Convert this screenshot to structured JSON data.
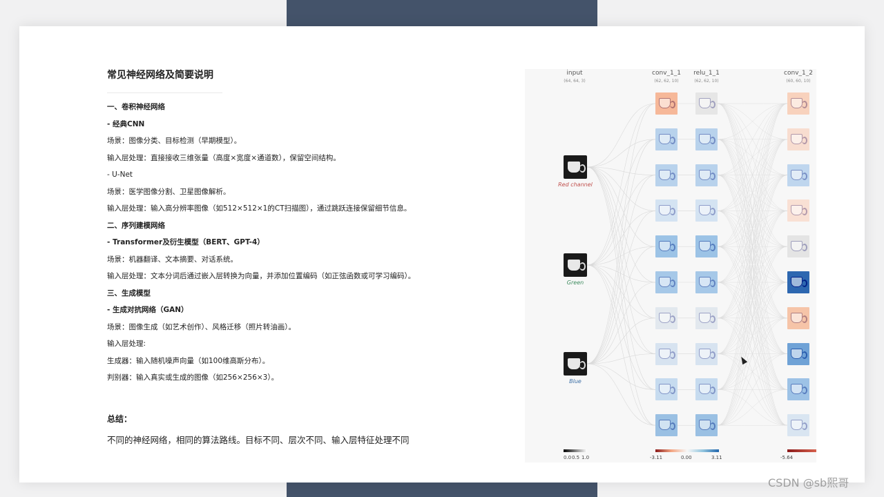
{
  "slide": {
    "title": "常见神经网络及简要说明",
    "lines": [
      {
        "text": "一、卷积神经网络",
        "bold": true
      },
      {
        "text": "- 经典CNN",
        "bold": true
      },
      {
        "text": "场景：图像分类、目标检测（早期模型）。",
        "bold": false
      },
      {
        "text": "输入层处理：直接接收三维张量（高度×宽度×通道数），保留空间结构。",
        "bold": false
      },
      {
        "text": "- U-Net",
        "bold": false
      },
      {
        "text": "场景：医学图像分割、卫星图像解析。",
        "bold": false
      },
      {
        "text": "输入层处理：输入高分辨率图像（如512×512×1的CT扫描图），通过跳跃连接保留细节信息。",
        "bold": false
      },
      {
        "text": "二、序列建模网络",
        "bold": true
      },
      {
        "text": "- Transformer及衍生模型（BERT、GPT-4）",
        "bold": true
      },
      {
        "text": "场景：机器翻译、文本摘要、对话系统。",
        "bold": false
      },
      {
        "text": "输入层处理：文本分词后通过嵌入层转换为向量，并添加位置编码（如正弦函数或可学习编码）。",
        "bold": false
      },
      {
        "text": "三、生成模型",
        "bold": true
      },
      {
        "text": "- 生成对抗网络（GAN）",
        "bold": true
      },
      {
        "text": "场景：图像生成（如艺术创作）、风格迁移（照片转油画）。",
        "bold": false
      },
      {
        "text": "输入层处理:",
        "bold": false
      },
      {
        "text": "生成器：输入随机噪声向量（如100维高斯分布）。",
        "bold": false
      },
      {
        "text": "判别器：输入真实或生成的图像（如256×256×3）。",
        "bold": false
      }
    ],
    "summary_label": "总结：",
    "summary_text": "不同的神经网络，相同的算法路线。目标不同、层次不同、输入层特征处理不同"
  },
  "viz": {
    "layers": [
      {
        "name": "input",
        "dims": "(64, 64, 3)"
      },
      {
        "name": "conv_1_1",
        "dims": "(62, 62, 10)"
      },
      {
        "name": "relu_1_1",
        "dims": "(62, 62, 10)"
      },
      {
        "name": "conv_1_2",
        "dims": "(60, 60, 10)"
      }
    ],
    "inputs": [
      {
        "label": "Red channel",
        "color": "#c0504d"
      },
      {
        "label": "Green",
        "color": "#3d8b5e"
      },
      {
        "label": "Blue",
        "color": "#3a6ea5"
      }
    ],
    "conv1_tints": [
      "#f6b899",
      "#b8d2ec",
      "#b8d2ec",
      "#d4e3f2",
      "#9cc3e6",
      "#a6c8e8",
      "#e2e8ee",
      "#d7e3f0",
      "#c6dbef",
      "#9ac0e3"
    ],
    "relu1_tints": [
      "#e6e6e6",
      "#b8d2ec",
      "#b8d2ec",
      "#d4e3f2",
      "#9cc3e6",
      "#a6c8e8",
      "#e2e8ee",
      "#d7e3f0",
      "#c6dbef",
      "#9ac0e3"
    ],
    "conv2_tints": [
      "#f8d2bd",
      "#f8ddd0",
      "#bfd6ee",
      "#f9e0d4",
      "#e4e4e4",
      "#2d67b0",
      "#f6c4a8",
      "#6fa2d6",
      "#9dc2e6",
      "#d9e5f1"
    ],
    "colorbars": [
      {
        "ticks": [
          "0.0",
          "0.5",
          "1.0"
        ]
      },
      {
        "ticks": [
          "-3.11",
          "0.00",
          "3.11"
        ]
      },
      {
        "ticks": [
          "-5.64"
        ]
      }
    ]
  },
  "watermark": "CSDN @sb熙哥"
}
